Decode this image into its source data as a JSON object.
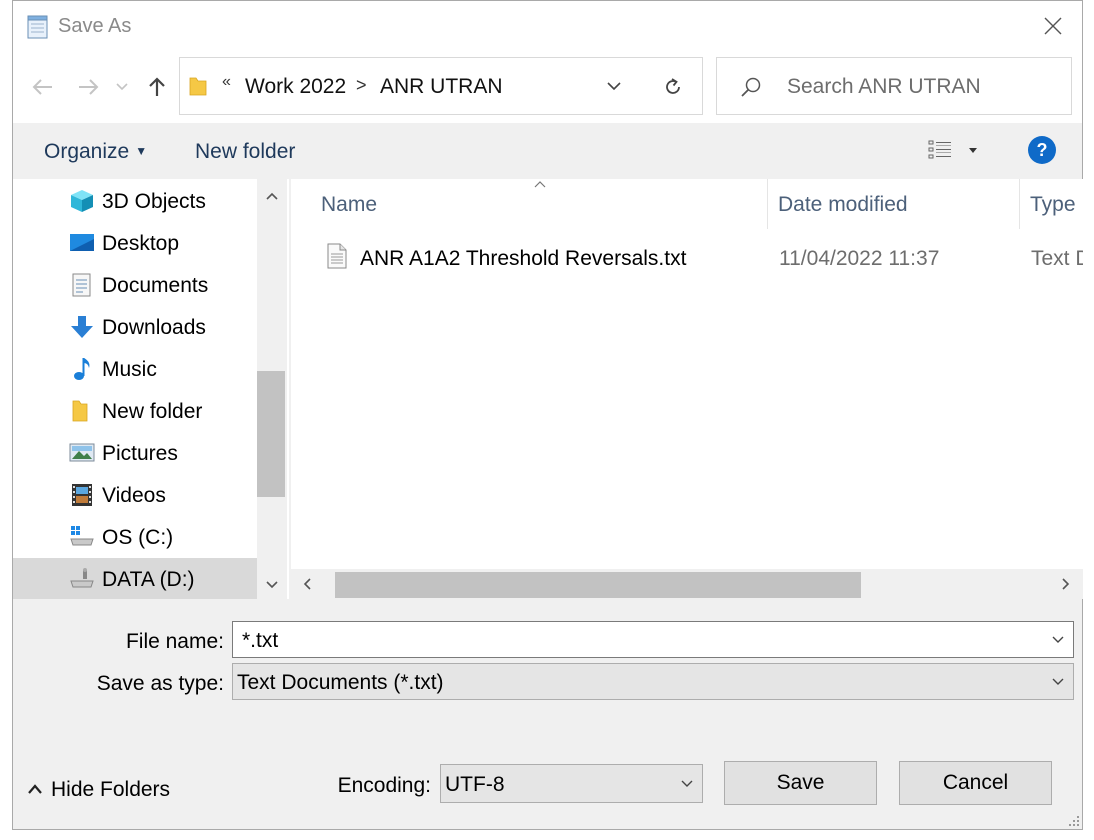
{
  "window": {
    "title": "Save As"
  },
  "address": {
    "overflow": "«",
    "segments": [
      "Work 2022",
      "ANR UTRAN"
    ],
    "separator": ">"
  },
  "search": {
    "placeholder": "Search ANR UTRAN"
  },
  "toolbar": {
    "organize": "Organize",
    "new_folder": "New folder",
    "help": "?"
  },
  "sidebar": {
    "items": [
      {
        "label": "3D Objects",
        "icon": "3d-objects-icon"
      },
      {
        "label": "Desktop",
        "icon": "desktop-icon"
      },
      {
        "label": "Documents",
        "icon": "documents-icon"
      },
      {
        "label": "Downloads",
        "icon": "downloads-icon"
      },
      {
        "label": "Music",
        "icon": "music-icon"
      },
      {
        "label": "New folder",
        "icon": "folder-icon"
      },
      {
        "label": "Pictures",
        "icon": "pictures-icon"
      },
      {
        "label": "Videos",
        "icon": "videos-icon"
      },
      {
        "label": "OS (C:)",
        "icon": "drive-icon"
      },
      {
        "label": "DATA (D:)",
        "icon": "drive-icon",
        "selected": true
      }
    ]
  },
  "files": {
    "columns": [
      "Name",
      "Date modified",
      "Type"
    ],
    "rows": [
      {
        "name": "ANR A1A2 Threshold Reversals.txt",
        "date": "11/04/2022 11:37",
        "type": "Text D"
      }
    ]
  },
  "form": {
    "file_name_label": "File name:",
    "file_name_value": "*.txt",
    "save_type_label": "Save as type:",
    "save_type_value": "Text Documents (*.txt)",
    "encoding_label": "Encoding:",
    "encoding_value": "UTF-8"
  },
  "footer": {
    "hide_folders": "Hide Folders",
    "save": "Save",
    "cancel": "Cancel"
  },
  "colors": {
    "accent": "#0f6ac8",
    "selection": "#d9d9d9",
    "toolbar_text": "#1e395b"
  }
}
